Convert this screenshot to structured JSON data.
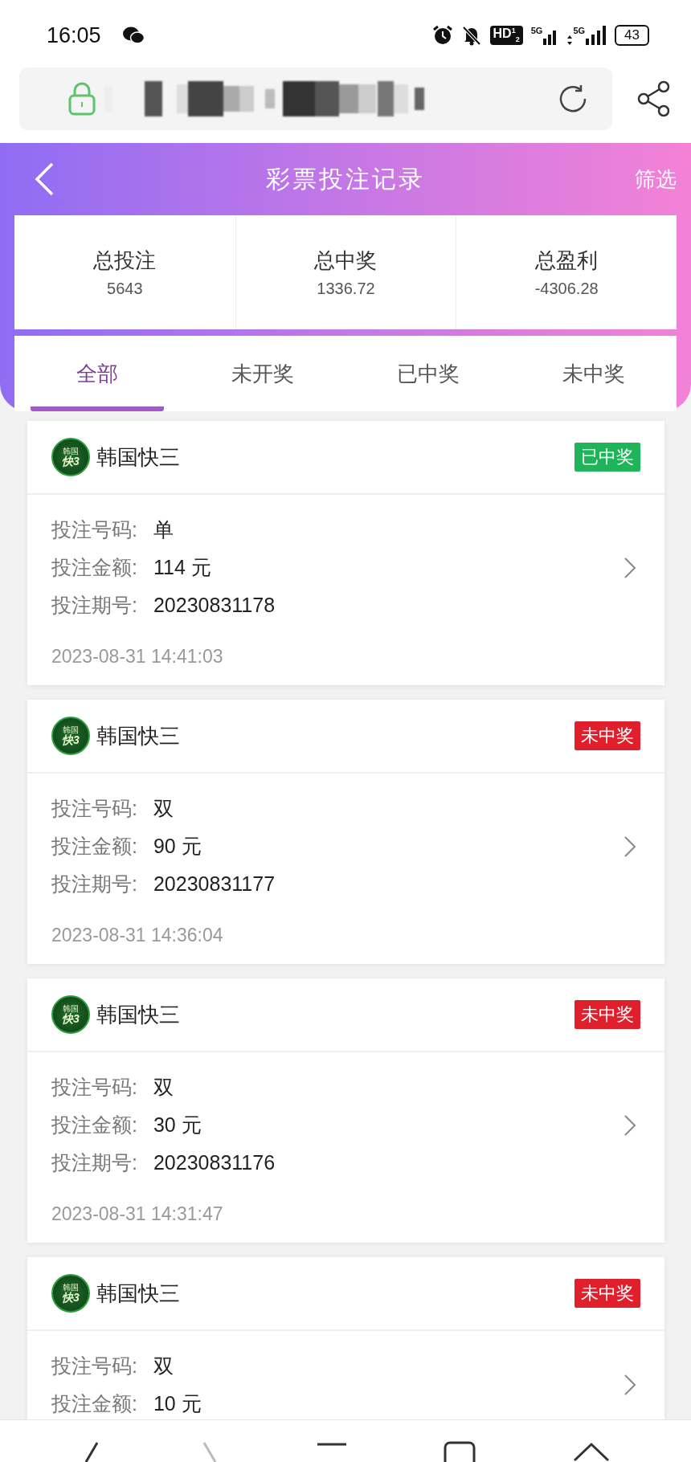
{
  "status_bar": {
    "time": "16:05",
    "hd": "HD$^{1}$$_{2}$",
    "network_1": "5G",
    "network_2": "5G",
    "battery": "43"
  },
  "header": {
    "title": "彩票投注记录",
    "filter": "筛选"
  },
  "summary": [
    {
      "label": "总投注",
      "value": "5643"
    },
    {
      "label": "总中奖",
      "value": "1336.72"
    },
    {
      "label": "总盈利",
      "value": "-4306.28"
    }
  ],
  "tabs": [
    {
      "label": "全部",
      "selected": true
    },
    {
      "label": "未开奖",
      "selected": false
    },
    {
      "label": "已中奖",
      "selected": false
    },
    {
      "label": "未中奖",
      "selected": false
    }
  ],
  "records": [
    {
      "game": "韩国快三",
      "logo_top": "韩国",
      "logo_bottom": "快3",
      "status": "已中奖",
      "kind": "won",
      "fields": [
        {
          "label": "投注号码:",
          "value": "单"
        },
        {
          "label": "投注金额:",
          "value": "114 元"
        },
        {
          "label": "投注期号:",
          "value": "20230831178"
        }
      ],
      "time": "2023-08-31 14:41:03"
    },
    {
      "game": "韩国快三",
      "logo_top": "韩国",
      "logo_bottom": "快3",
      "status": "未中奖",
      "kind": "lost",
      "fields": [
        {
          "label": "投注号码:",
          "value": "双"
        },
        {
          "label": "投注金额:",
          "value": "90 元"
        },
        {
          "label": "投注期号:",
          "value": "20230831177"
        }
      ],
      "time": "2023-08-31 14:36:04"
    },
    {
      "game": "韩国快三",
      "logo_top": "韩国",
      "logo_bottom": "快3",
      "status": "未中奖",
      "kind": "lost",
      "fields": [
        {
          "label": "投注号码:",
          "value": "双"
        },
        {
          "label": "投注金额:",
          "value": "30 元"
        },
        {
          "label": "投注期号:",
          "value": "20230831176"
        }
      ],
      "time": "2023-08-31 14:31:47"
    },
    {
      "game": "韩国快三",
      "logo_top": "韩国",
      "logo_bottom": "快3",
      "status": "未中奖",
      "kind": "lost",
      "fields": [
        {
          "label": "投注号码:",
          "value": "双"
        },
        {
          "label": "投注金额:",
          "value": "10 元"
        }
      ]
    }
  ]
}
